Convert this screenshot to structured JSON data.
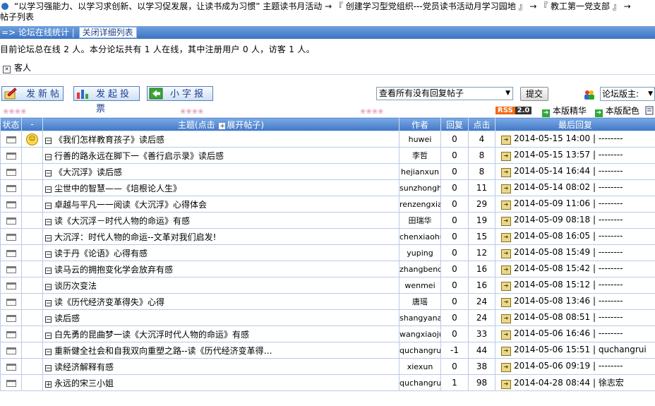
{
  "breadcrumb": {
    "line1": "“以学习强能力、以学习求创新、以学习促发展，让读书成为习惯” 主题读书月活动 → 『 创建学习型党组织---党员读书活动月学习园地 』 → 『 教工第一党支部 』 →",
    "line2": "帖子列表"
  },
  "stat_bar": {
    "label": "=> 论坛在线统计",
    "separator": " | ",
    "toggle": "关闭详细列表"
  },
  "online_text": "目前论坛总在线 2 人。本分论坛共有 1 人在线，其中注册用户 0 人，访客 1 人。",
  "guest_label": "客人",
  "toolbar": {
    "new_post": "发新帖",
    "new_poll": "发起投票",
    "small_mode": "小字报"
  },
  "filter": {
    "selected": "查看所有没有回复帖子",
    "submit": "提交"
  },
  "moderator_select": "论坛版主:",
  "rss": {
    "badge": "RSS",
    "version": "2.0"
  },
  "feature_links": {
    "digest": "本版精华",
    "colors": "本版配色"
  },
  "colors": {
    "accent": "#4277c6",
    "rss": "#f06a14"
  },
  "table": {
    "headers": {
      "status": "状态",
      "mood": "-",
      "topic": "主题(点击",
      "expand_hint": "展开帖子)",
      "author": "作者",
      "replies": "回复",
      "views": "点击",
      "last_reply": "最后回复"
    },
    "rows": [
      {
        "title": "《我们怎样教育孩子》读后感",
        "author": "huwei",
        "replies": "0",
        "views": "4",
        "last": "2014-05-15 14:00",
        "last_user": "| --------",
        "mood": true
      },
      {
        "title": "行善的路永远在脚下一《善行启示录》读后感",
        "author": "李哲",
        "replies": "0",
        "views": "8",
        "last": "2014-05-15 13:57",
        "last_user": "| --------"
      },
      {
        "title": "《大沉浮》读后感",
        "author": "hejianxun",
        "replies": "0",
        "views": "8",
        "last": "2014-05-14 16:44",
        "last_user": "| --------"
      },
      {
        "title": "尘世中的智慧——《培根论人生》",
        "author": "sunzhonghua",
        "replies": "0",
        "views": "11",
        "last": "2014-05-14 08:02",
        "last_user": "| --------"
      },
      {
        "title": "卓越与平凡一一阅读《大沉浮》心得体会",
        "author": "renzengxia",
        "replies": "0",
        "views": "29",
        "last": "2014-05-09 11:06",
        "last_user": "| --------"
      },
      {
        "title": "读《大沉浮－时代人物的命运》有感",
        "author": "田瑞华",
        "replies": "0",
        "views": "19",
        "last": "2014-05-09 08:18",
        "last_user": "| --------"
      },
      {
        "title": "大沉浮：时代人物的命运--文革对我们启发!",
        "author": "chenxiaohua",
        "replies": "0",
        "views": "15",
        "last": "2014-05-08 16:05",
        "last_user": "| --------"
      },
      {
        "title": "读于丹《论语》心得有感",
        "author": "yuping",
        "replies": "0",
        "views": "12",
        "last": "2014-05-08 15:49",
        "last_user": "| --------"
      },
      {
        "title": "读马云的拥抱变化学会放弃有感",
        "author": "zhangbenqing",
        "replies": "0",
        "views": "16",
        "last": "2014-05-08 15:42",
        "last_user": "| --------"
      },
      {
        "title": "谈历次变法",
        "author": "wenmei",
        "replies": "0",
        "views": "16",
        "last": "2014-05-08 15:12",
        "last_user": "| --------"
      },
      {
        "title": "读《历代经济变革得失》心得",
        "author": "唐瑶",
        "replies": "0",
        "views": "24",
        "last": "2014-05-08 13:46",
        "last_user": "| --------"
      },
      {
        "title": "读后感",
        "author": "shangyana",
        "replies": "0",
        "views": "24",
        "last": "2014-05-08 08:51",
        "last_user": "| --------"
      },
      {
        "title": "白先勇的昆曲梦一读《大沉浮时代人物的命运》有感",
        "author": "wangxiaojun",
        "replies": "0",
        "views": "33",
        "last": "2014-05-06 16:46",
        "last_user": "| --------"
      },
      {
        "title": "重新健全社会和自我双向重塑之路--读《历代经济变革得…",
        "author": "quchangrui",
        "replies": "-1",
        "views": "44",
        "last": "2014-05-06 15:51",
        "last_user": "| quchangrui"
      },
      {
        "title": "读经济解释有感",
        "author": "xiexun",
        "replies": "0",
        "views": "38",
        "last": "2014-05-06 09:19",
        "last_user": "| --------"
      },
      {
        "title": "永远的宋三小姐",
        "author": "quchangrui",
        "replies": "1",
        "views": "98",
        "last": "2014-04-28 08:44",
        "last_user": "| 徐志宏",
        "plus": true
      }
    ]
  }
}
